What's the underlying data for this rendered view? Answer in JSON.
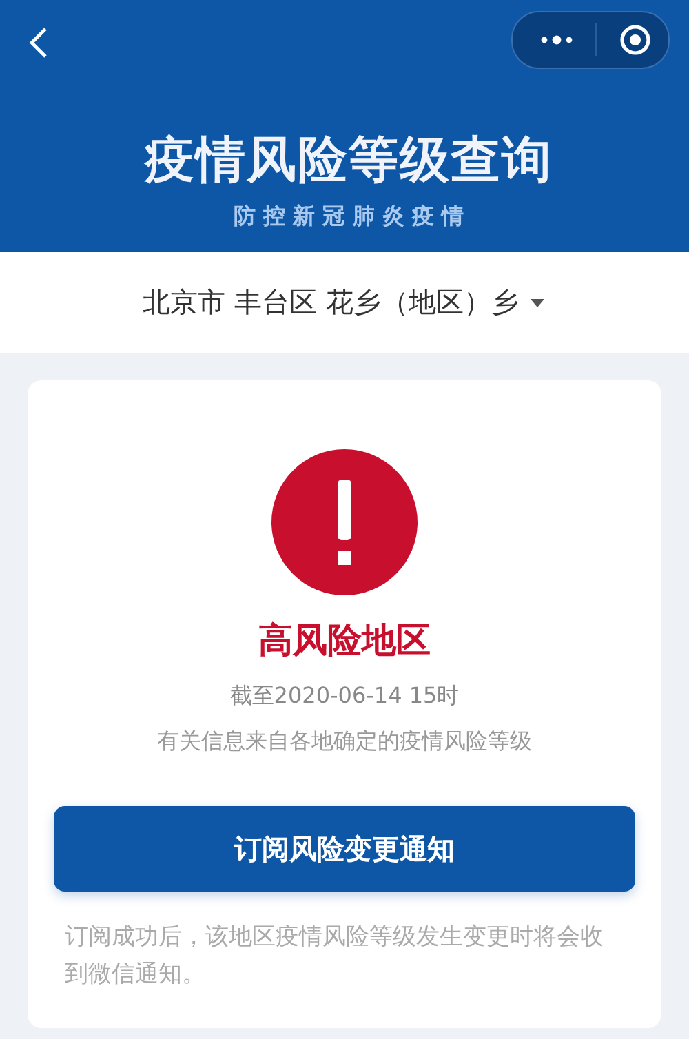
{
  "header": {
    "title": "疫情风险等级查询",
    "subtitle": "防 控 新 冠 肺 炎 疫 情"
  },
  "location": {
    "text": "北京市 丰台区 花乡（地区）乡"
  },
  "result": {
    "risk": "高风险地区",
    "date": "截至2020-06-14 15时",
    "source": "有关信息来自各地确定的疫情风险等级"
  },
  "subscribe_button": "订阅风险变更通知",
  "note": "订阅成功后，该地区疫情风险等级发生变更时将会收到微信通知。"
}
